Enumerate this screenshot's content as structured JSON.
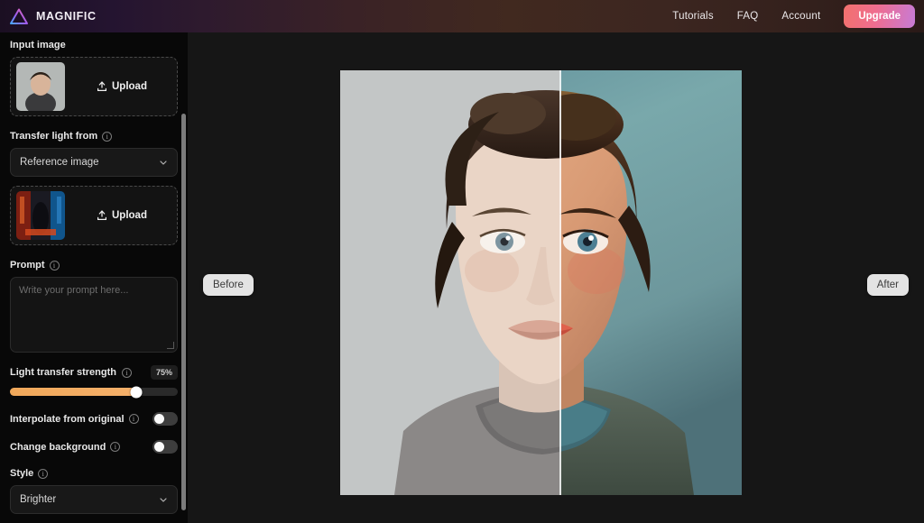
{
  "header": {
    "brand": "MAGNIFIC",
    "logo_icon": "triangle-logo-icon",
    "nav": [
      {
        "label": "Tutorials",
        "name": "nav-tutorials"
      },
      {
        "label": "FAQ",
        "name": "nav-faq"
      },
      {
        "label": "Account",
        "name": "nav-account"
      }
    ],
    "upgrade_label": "Upgrade",
    "upgrade_gradient": [
      "#f2716d",
      "#c77bd6"
    ]
  },
  "sidebar": {
    "input_image": {
      "label": "Input image",
      "upload_label": "Upload",
      "upload_icon": "upload-icon",
      "thumbnail": "portrait-thumbnail"
    },
    "transfer_light": {
      "label": "Transfer light from",
      "info_icon": "info-icon",
      "selected_option": "Reference image",
      "options": [
        "Reference image"
      ],
      "upload_label": "Upload",
      "upload_icon": "upload-icon",
      "thumbnail": "reference-poster-thumbnail"
    },
    "prompt": {
      "label": "Prompt",
      "info_icon": "info-icon",
      "value": "",
      "placeholder": "Write your prompt here..."
    },
    "light_transfer_strength": {
      "label": "Light transfer strength",
      "info_icon": "info-icon",
      "value_text": "75%",
      "value": 75,
      "fill_color": "#f0a85a"
    },
    "interpolate_from_original": {
      "label": "Interpolate from original",
      "info_icon": "info-icon",
      "state": "off"
    },
    "change_background": {
      "label": "Change background",
      "info_icon": "info-icon",
      "state": "off"
    },
    "style": {
      "label": "Style",
      "info_icon": "info-icon",
      "selected_option": "Brighter",
      "options": [
        "Brighter"
      ]
    }
  },
  "canvas": {
    "before_label": "Before",
    "after_label": "After",
    "divider": "comparison-slider-divider"
  }
}
